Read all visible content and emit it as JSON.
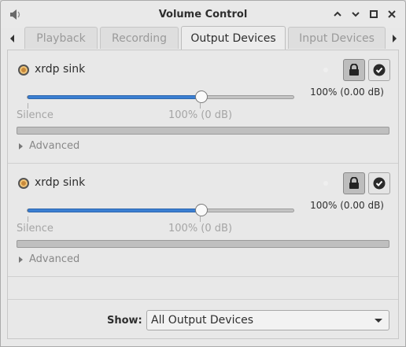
{
  "window": {
    "title": "Volume Control",
    "icons": {
      "app": "speaker-icon",
      "minimize": "minimize-icon",
      "maximize": "maximize-icon",
      "close": "close-icon"
    }
  },
  "tabs": [
    {
      "label": "Playback",
      "active": false
    },
    {
      "label": "Recording",
      "active": false
    },
    {
      "label": "Output Devices",
      "active": true
    },
    {
      "label": "Input Devices",
      "active": false
    }
  ],
  "devices": [
    {
      "name": "xrdp sink",
      "volume_text": "100% (0.00 dB)",
      "volume_fraction": 0.653,
      "scale_min_label": "Silence",
      "scale_mark_label": "100% (0 dB)",
      "advanced_label": "Advanced"
    },
    {
      "name": "xrdp sink",
      "volume_text": "100% (0.00 dB)",
      "volume_fraction": 0.653,
      "scale_min_label": "Silence",
      "scale_mark_label": "100% (0 dB)",
      "advanced_label": "Advanced"
    }
  ],
  "footer": {
    "show_label": "Show:",
    "show_value": "All Output Devices"
  },
  "colors": {
    "accent": "#3b7fd2",
    "background": "#e8e8e8"
  }
}
